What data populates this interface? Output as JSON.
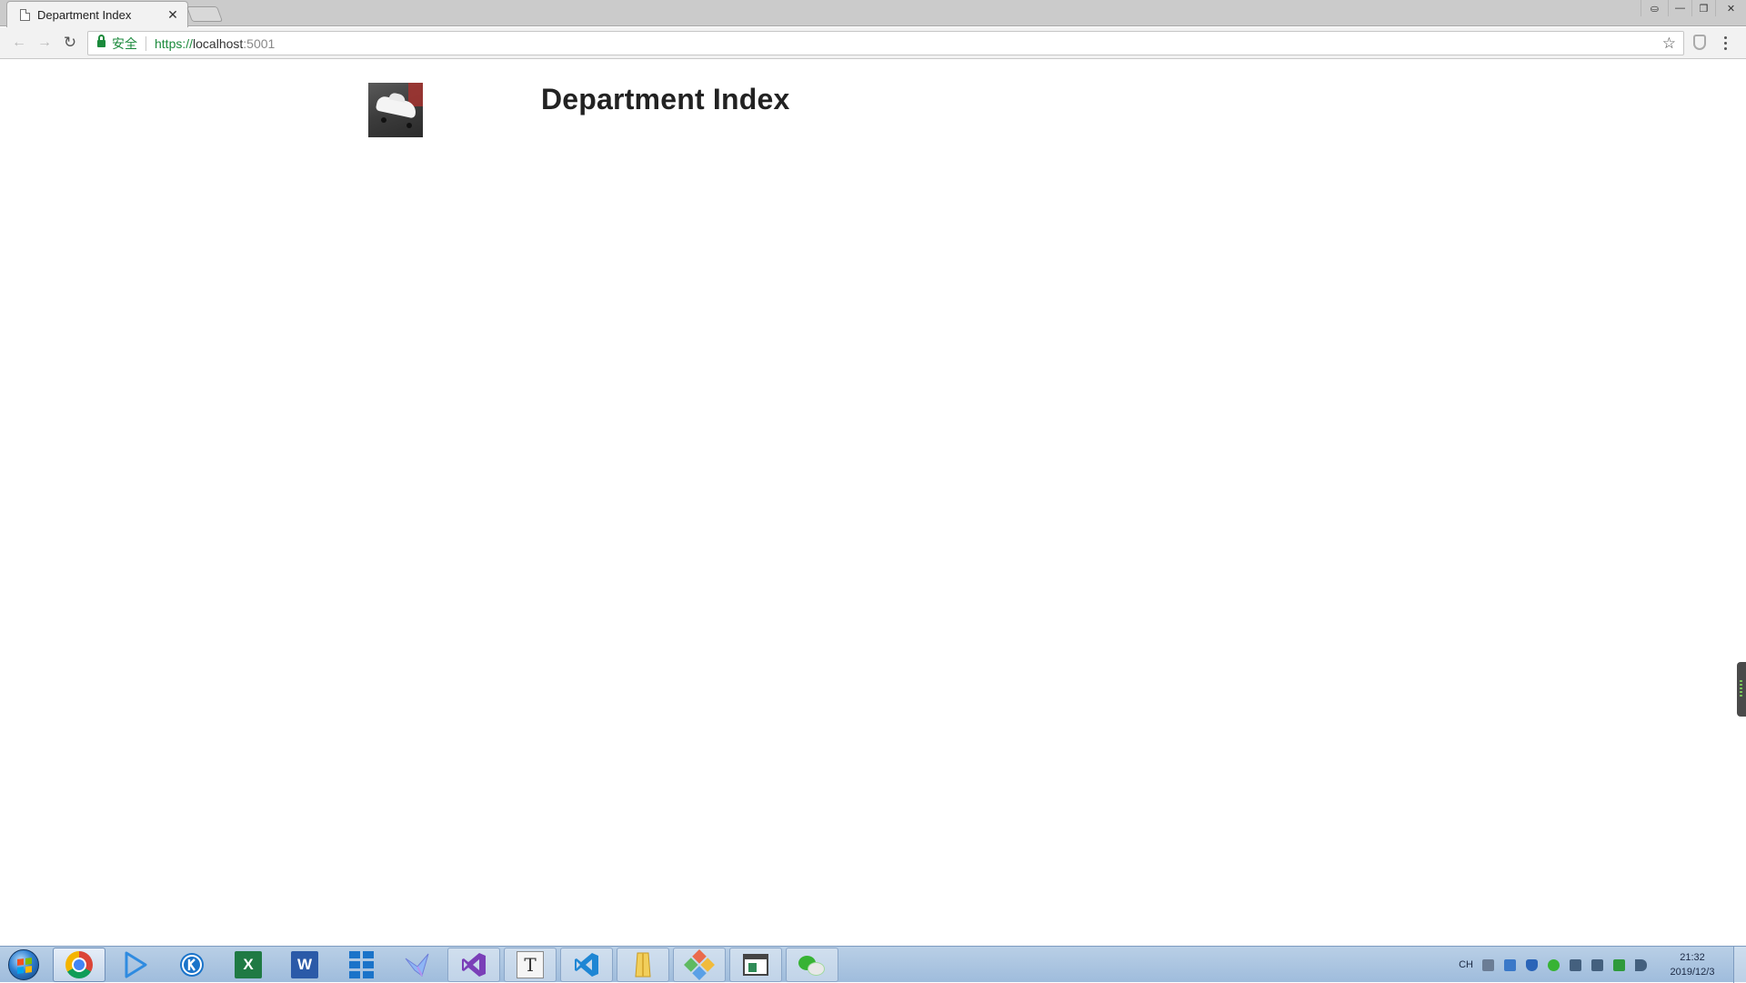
{
  "browser": {
    "tab": {
      "title": "Department Index",
      "close_glyph": "✕"
    },
    "window_controls": {
      "profile": "⛀",
      "minimize": "—",
      "maximize": "❐",
      "close": "✕"
    },
    "nav": {
      "back": "←",
      "forward": "→",
      "reload": "↻"
    },
    "omnibox": {
      "secure_label": "安全",
      "url_scheme": "https://",
      "url_host": "localhost",
      "url_port": ":5001"
    },
    "bookmark_glyph": "☆"
  },
  "page": {
    "heading": "Department Index",
    "logo_alt": "car-logo"
  },
  "taskbar": {
    "apps": [
      {
        "name": "chrome",
        "active": true
      },
      {
        "name": "media-player"
      },
      {
        "name": "k-app"
      },
      {
        "name": "excel",
        "label": "X"
      },
      {
        "name": "word",
        "label": "W"
      },
      {
        "name": "grid-app"
      },
      {
        "name": "bird-app"
      },
      {
        "name": "visual-studio",
        "framed": true
      },
      {
        "name": "typora",
        "label": "T",
        "framed": true
      },
      {
        "name": "vscode",
        "framed": true
      },
      {
        "name": "file-explorer",
        "framed": true
      },
      {
        "name": "sourcetree",
        "framed": true
      },
      {
        "name": "window-app",
        "framed": true
      },
      {
        "name": "wechat",
        "framed": true
      }
    ],
    "tray": {
      "language": "CH",
      "time": "21:32",
      "date": "2019/12/3",
      "icon_colors": [
        "#6b7d95",
        "#3a78c8",
        "#2a64b8",
        "#37b334",
        "#44607e",
        "#44607e",
        "#2f9a3c",
        "#44607e"
      ]
    }
  },
  "colors": {
    "secure_green": "#1b8a3c",
    "taskbar_top": "#b9cfe6",
    "taskbar_bottom": "#9fbcdc"
  }
}
